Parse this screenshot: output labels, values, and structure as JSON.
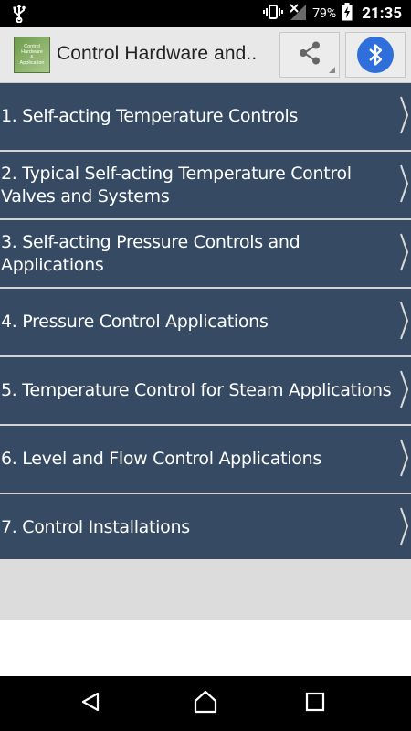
{
  "status_bar": {
    "battery_percent": "79%",
    "time": "21:35",
    "icons": [
      "usb-icon",
      "vibrate-icon",
      "no-signal-icon",
      "battery-charging-icon"
    ]
  },
  "action_bar": {
    "logo_text": "Control\nHardware\n&\nApplication",
    "title": "Control Hardware and..",
    "share_icon": "share-icon",
    "bluetooth_icon": "bluetooth-icon"
  },
  "menu": {
    "items": [
      {
        "label": "1. Self-acting Temperature Controls"
      },
      {
        "label": "2. Typical Self-acting Temperature Control Valves and Systems"
      },
      {
        "label": "3. Self-acting Pressure Controls and Applications"
      },
      {
        "label": "4. Pressure Control Applications"
      },
      {
        "label": "5. Temperature Control for Steam Applications"
      },
      {
        "label": "6. Level and Flow Control Applications"
      },
      {
        "label": "7. Control Installations"
      }
    ],
    "chevron_icon": "chevron-right-icon"
  },
  "nav_bar": {
    "icons": [
      "back-icon",
      "home-icon",
      "recents-icon"
    ]
  },
  "colors": {
    "item_background": "#364b63",
    "divider": "#d3d3d3",
    "bluetooth_accent": "#2f6fdc"
  }
}
